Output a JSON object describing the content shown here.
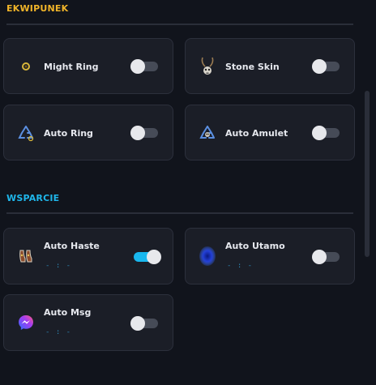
{
  "sections": {
    "equipment": {
      "title": "EKWIPUNEK",
      "color": "#f0b429"
    },
    "support": {
      "title": "WSPARCIE",
      "color": "#1fb6ea"
    }
  },
  "equipment_items": [
    {
      "label": "Might Ring",
      "icon": "ring-icon",
      "enabled": false
    },
    {
      "label": "Stone Skin",
      "icon": "amulet-skull-icon",
      "enabled": false
    },
    {
      "label": "Auto Ring",
      "icon": "recycle-ring-icon",
      "enabled": false
    },
    {
      "label": "Auto Amulet",
      "icon": "recycle-amulet-icon",
      "enabled": false
    }
  ],
  "support_items": [
    {
      "label": "Auto Haste",
      "sub": "- : -",
      "icon": "boots-icon",
      "enabled": true
    },
    {
      "label": "Auto Utamo",
      "sub": "- : -",
      "icon": "magic-shield-icon",
      "enabled": false
    },
    {
      "label": "Auto Msg",
      "sub": "- : -",
      "icon": "messenger-icon",
      "enabled": false
    }
  ]
}
